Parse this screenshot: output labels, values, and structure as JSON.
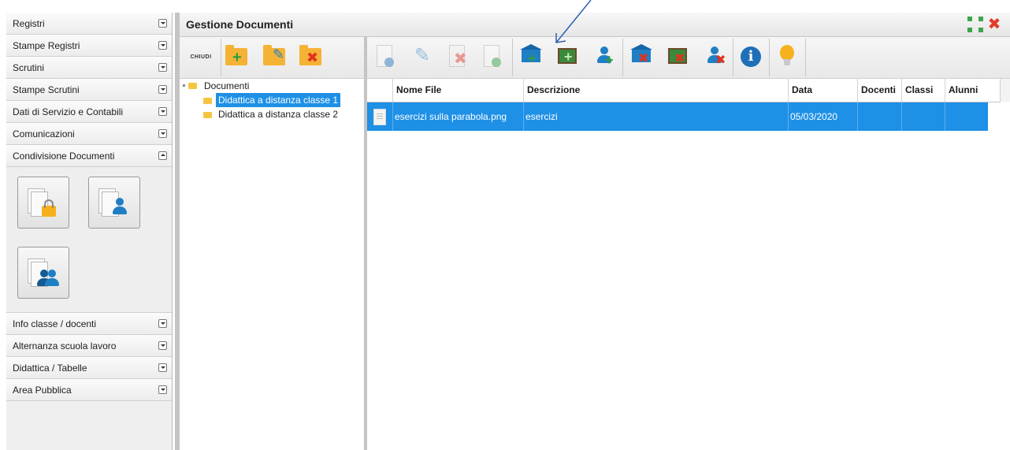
{
  "sidebar": {
    "top_items": [
      {
        "label": "Registri"
      },
      {
        "label": "Stampe Registri"
      },
      {
        "label": "Scrutini"
      },
      {
        "label": "Stampe Scrutini"
      },
      {
        "label": "Dati di Servizio e Contabili"
      },
      {
        "label": "Comunicazioni"
      },
      {
        "label": "Condivisione Documenti"
      }
    ],
    "bottom_items": [
      {
        "label": "Info classe / docenti"
      },
      {
        "label": "Alternanza scuola lavoro"
      },
      {
        "label": "Didattica / Tabelle"
      },
      {
        "label": "Area Pubblica"
      }
    ],
    "tiles": [
      {
        "icon": "private-documents-lock-icon"
      },
      {
        "icon": "personal-documents-icon"
      },
      {
        "icon": "shared-documents-group-icon"
      }
    ]
  },
  "main": {
    "title": "Gestione Documenti",
    "header_icons": [
      "maximize-icon",
      "close-icon"
    ],
    "close_glyph": "✖"
  },
  "tree_toolbar": {
    "close_label": "CHIUDI",
    "buttons": [
      "add-folder-icon",
      "edit-folder-icon",
      "delete-folder-icon"
    ]
  },
  "tree": {
    "root": "Documenti",
    "children": [
      {
        "label": "Didattica a distanza classe 1",
        "selected": true
      },
      {
        "label": "Didattica a distanza classe 2",
        "selected": false
      }
    ]
  },
  "docs_toolbar": {
    "buttons": [
      "new-document-icon",
      "edit-document-icon",
      "delete-document-icon",
      "new-version-icon",
      "share-with-class-icon",
      "share-with-board-icon",
      "share-with-user-icon",
      "unshare-class-icon",
      "unshare-board-icon",
      "unshare-user-icon",
      "info-icon",
      "lightbulb-icon"
    ]
  },
  "table": {
    "columns": [
      "Nome File",
      "Descrizione",
      "Data",
      "Docenti",
      "Classi",
      "Alunni"
    ],
    "rows": [
      {
        "file": "esercizi sulla parabola.png",
        "description": "esercizi",
        "date": "05/03/2020",
        "docenti": "",
        "classi": "",
        "alunni": ""
      }
    ]
  },
  "colors": {
    "selection": "#1e90e6",
    "folder": "#f5b335",
    "accent_blue": "#1f7fc4",
    "close_red": "#e23c2a",
    "annotation_arrow": "#2f5fb3"
  }
}
